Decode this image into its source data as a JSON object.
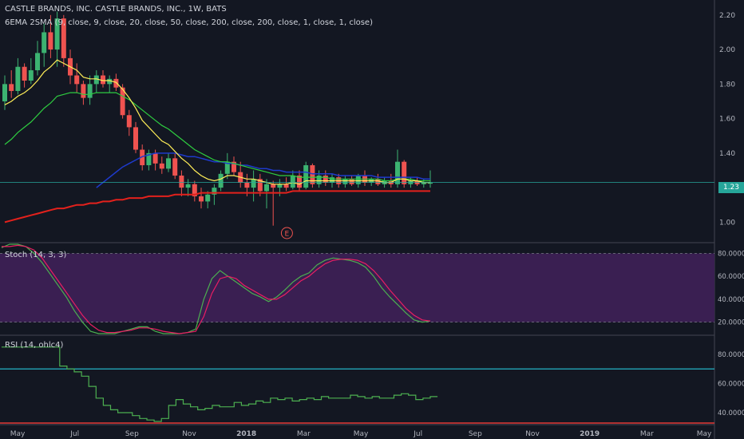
{
  "header": {
    "title": "CASTLE BRANDS, INC. CASTLE BRANDS, INC., 1W, BATS",
    "indicators_label": "6EMA 2SMA (9, close, 9, close, 20, close, 50, close, 200, close, 200, close, 1, close, 1, close)"
  },
  "price_pane": {
    "last_price_label": "1.23",
    "earnings_marker": "E"
  },
  "stoch_pane": {
    "label": "Stoch (14, 3, 3)"
  },
  "rsi_pane": {
    "label": "RSI (14, ohlc4)"
  },
  "colors": {
    "background": "#131722",
    "up": "#26a69a",
    "up_candle": "#3cb371",
    "down": "#ef5350",
    "ema9": "#ffee58",
    "ema20": "#2ecc40",
    "ema50": "#1e3acb",
    "ma200": "#e3211c",
    "stoch_k": "#4caf50",
    "stoch_d": "#e91e63",
    "stoch_band": "#3a1f52",
    "rsi": "#4caf50",
    "rsi_upper": "#26c6da",
    "rsi_lower": "#e53935"
  },
  "chart_data": [
    {
      "type": "candlestick",
      "price_ylim": [
        0.9,
        2.25
      ],
      "y_ticks": [
        "2.20",
        "2.00",
        "1.80",
        "1.60",
        "1.40",
        "1.20",
        "1.00"
      ],
      "x_ticks": [
        "May",
        "Jul",
        "Sep",
        "Nov",
        "2018",
        "Mar",
        "May",
        "Jul",
        "Sep",
        "Nov",
        "2019",
        "Mar",
        "May"
      ],
      "last_price": 1.23,
      "candles": [
        {
          "o": 1.7,
          "h": 1.85,
          "l": 1.65,
          "c": 1.8
        },
        {
          "o": 1.8,
          "h": 1.88,
          "l": 1.72,
          "c": 1.76
        },
        {
          "o": 1.76,
          "h": 1.95,
          "l": 1.74,
          "c": 1.9
        },
        {
          "o": 1.9,
          "h": 1.92,
          "l": 1.78,
          "c": 1.82
        },
        {
          "o": 1.82,
          "h": 1.95,
          "l": 1.8,
          "c": 1.88
        },
        {
          "o": 1.88,
          "h": 2.05,
          "l": 1.85,
          "c": 1.98
        },
        {
          "o": 1.98,
          "h": 2.15,
          "l": 1.9,
          "c": 2.1
        },
        {
          "o": 2.1,
          "h": 2.2,
          "l": 1.95,
          "c": 2.0
        },
        {
          "o": 2.0,
          "h": 2.22,
          "l": 1.9,
          "c": 2.18
        },
        {
          "o": 2.18,
          "h": 2.2,
          "l": 1.9,
          "c": 1.95
        },
        {
          "o": 1.95,
          "h": 2.0,
          "l": 1.8,
          "c": 1.85
        },
        {
          "o": 1.85,
          "h": 1.92,
          "l": 1.75,
          "c": 1.8
        },
        {
          "o": 1.8,
          "h": 1.82,
          "l": 1.68,
          "c": 1.72
        },
        {
          "o": 1.72,
          "h": 1.85,
          "l": 1.68,
          "c": 1.8
        },
        {
          "o": 1.8,
          "h": 1.88,
          "l": 1.75,
          "c": 1.85
        },
        {
          "o": 1.85,
          "h": 1.88,
          "l": 1.78,
          "c": 1.8
        },
        {
          "o": 1.8,
          "h": 1.85,
          "l": 1.75,
          "c": 1.83
        },
        {
          "o": 1.83,
          "h": 1.86,
          "l": 1.76,
          "c": 1.78
        },
        {
          "o": 1.78,
          "h": 1.8,
          "l": 1.6,
          "c": 1.62
        },
        {
          "o": 1.62,
          "h": 1.65,
          "l": 1.5,
          "c": 1.55
        },
        {
          "o": 1.55,
          "h": 1.58,
          "l": 1.4,
          "c": 1.42
        },
        {
          "o": 1.42,
          "h": 1.45,
          "l": 1.3,
          "c": 1.33
        },
        {
          "o": 1.33,
          "h": 1.42,
          "l": 1.3,
          "c": 1.4
        },
        {
          "o": 1.4,
          "h": 1.42,
          "l": 1.3,
          "c": 1.34
        },
        {
          "o": 1.34,
          "h": 1.38,
          "l": 1.28,
          "c": 1.31
        },
        {
          "o": 1.31,
          "h": 1.4,
          "l": 1.29,
          "c": 1.37
        },
        {
          "o": 1.37,
          "h": 1.4,
          "l": 1.25,
          "c": 1.27
        },
        {
          "o": 1.27,
          "h": 1.3,
          "l": 1.15,
          "c": 1.2
        },
        {
          "o": 1.2,
          "h": 1.25,
          "l": 1.15,
          "c": 1.22
        },
        {
          "o": 1.22,
          "h": 1.24,
          "l": 1.12,
          "c": 1.15
        },
        {
          "o": 1.15,
          "h": 1.2,
          "l": 1.08,
          "c": 1.12
        },
        {
          "o": 1.12,
          "h": 1.18,
          "l": 1.08,
          "c": 1.16
        },
        {
          "o": 1.16,
          "h": 1.22,
          "l": 1.1,
          "c": 1.2
        },
        {
          "o": 1.2,
          "h": 1.3,
          "l": 1.18,
          "c": 1.28
        },
        {
          "o": 1.28,
          "h": 1.4,
          "l": 1.25,
          "c": 1.35
        },
        {
          "o": 1.35,
          "h": 1.38,
          "l": 1.27,
          "c": 1.29
        },
        {
          "o": 1.29,
          "h": 1.35,
          "l": 1.2,
          "c": 1.23
        },
        {
          "o": 1.23,
          "h": 1.28,
          "l": 1.15,
          "c": 1.2
        },
        {
          "o": 1.2,
          "h": 1.3,
          "l": 1.12,
          "c": 1.25
        },
        {
          "o": 1.25,
          "h": 1.28,
          "l": 1.15,
          "c": 1.18
        },
        {
          "o": 1.18,
          "h": 1.25,
          "l": 1.08,
          "c": 1.22
        },
        {
          "o": 1.22,
          "h": 1.24,
          "l": 0.98,
          "c": 1.2
        },
        {
          "o": 1.2,
          "h": 1.25,
          "l": 1.15,
          "c": 1.22
        },
        {
          "o": 1.22,
          "h": 1.26,
          "l": 1.18,
          "c": 1.2
        },
        {
          "o": 1.2,
          "h": 1.3,
          "l": 1.19,
          "c": 1.27
        },
        {
          "o": 1.27,
          "h": 1.3,
          "l": 1.18,
          "c": 1.2
        },
        {
          "o": 1.2,
          "h": 1.35,
          "l": 1.19,
          "c": 1.33
        },
        {
          "o": 1.33,
          "h": 1.34,
          "l": 1.2,
          "c": 1.22
        },
        {
          "o": 1.22,
          "h": 1.3,
          "l": 1.2,
          "c": 1.27
        },
        {
          "o": 1.27,
          "h": 1.3,
          "l": 1.21,
          "c": 1.23
        },
        {
          "o": 1.23,
          "h": 1.28,
          "l": 1.2,
          "c": 1.26
        },
        {
          "o": 1.26,
          "h": 1.28,
          "l": 1.2,
          "c": 1.22
        },
        {
          "o": 1.22,
          "h": 1.27,
          "l": 1.2,
          "c": 1.25
        },
        {
          "o": 1.25,
          "h": 1.27,
          "l": 1.21,
          "c": 1.22
        },
        {
          "o": 1.22,
          "h": 1.28,
          "l": 1.2,
          "c": 1.27
        },
        {
          "o": 1.27,
          "h": 1.3,
          "l": 1.21,
          "c": 1.23
        },
        {
          "o": 1.23,
          "h": 1.26,
          "l": 1.21,
          "c": 1.25
        },
        {
          "o": 1.25,
          "h": 1.28,
          "l": 1.21,
          "c": 1.22
        },
        {
          "o": 1.22,
          "h": 1.26,
          "l": 1.2,
          "c": 1.24
        },
        {
          "o": 1.24,
          "h": 1.28,
          "l": 1.2,
          "c": 1.22
        },
        {
          "o": 1.22,
          "h": 1.42,
          "l": 1.2,
          "c": 1.35
        },
        {
          "o": 1.35,
          "h": 1.36,
          "l": 1.2,
          "c": 1.22
        },
        {
          "o": 1.22,
          "h": 1.26,
          "l": 1.2,
          "c": 1.24
        },
        {
          "o": 1.24,
          "h": 1.26,
          "l": 1.21,
          "c": 1.22
        },
        {
          "o": 1.22,
          "h": 1.25,
          "l": 1.2,
          "c": 1.23
        },
        {
          "o": 1.23,
          "h": 1.3,
          "l": 1.2,
          "c": 1.23
        }
      ],
      "ema9": [
        1.68,
        1.7,
        1.73,
        1.75,
        1.78,
        1.82,
        1.87,
        1.9,
        1.94,
        1.92,
        1.9,
        1.88,
        1.84,
        1.83,
        1.83,
        1.82,
        1.82,
        1.81,
        1.77,
        1.72,
        1.66,
        1.59,
        1.55,
        1.51,
        1.47,
        1.45,
        1.41,
        1.37,
        1.34,
        1.3,
        1.27,
        1.25,
        1.24,
        1.25,
        1.27,
        1.27,
        1.26,
        1.25,
        1.25,
        1.24,
        1.23,
        1.22,
        1.22,
        1.22,
        1.23,
        1.22,
        1.24,
        1.24,
        1.24,
        1.24,
        1.24,
        1.24,
        1.24,
        1.24,
        1.24,
        1.24,
        1.24,
        1.24,
        1.23,
        1.23,
        1.25,
        1.25,
        1.24,
        1.24,
        1.23,
        1.23
      ],
      "ema20": [
        1.45,
        1.48,
        1.52,
        1.55,
        1.58,
        1.62,
        1.66,
        1.69,
        1.73,
        1.74,
        1.75,
        1.75,
        1.74,
        1.74,
        1.75,
        1.75,
        1.75,
        1.75,
        1.73,
        1.71,
        1.68,
        1.65,
        1.62,
        1.59,
        1.56,
        1.54,
        1.51,
        1.48,
        1.45,
        1.42,
        1.4,
        1.38,
        1.36,
        1.35,
        1.35,
        1.34,
        1.33,
        1.32,
        1.31,
        1.3,
        1.29,
        1.28,
        1.27,
        1.27,
        1.27,
        1.26,
        1.26,
        1.26,
        1.26,
        1.26,
        1.25,
        1.25,
        1.25,
        1.25,
        1.25,
        1.25,
        1.25,
        1.25,
        1.24,
        1.24,
        1.25,
        1.25,
        1.25,
        1.24,
        1.24,
        1.24
      ],
      "ema50": [
        null,
        null,
        null,
        null,
        null,
        null,
        null,
        null,
        null,
        null,
        null,
        null,
        null,
        null,
        1.2,
        1.23,
        1.26,
        1.29,
        1.32,
        1.34,
        1.36,
        1.38,
        1.39,
        1.4,
        1.4,
        1.4,
        1.4,
        1.39,
        1.38,
        1.38,
        1.37,
        1.36,
        1.35,
        1.35,
        1.34,
        1.34,
        1.33,
        1.33,
        1.32,
        1.31,
        1.31,
        1.3,
        1.3,
        1.29,
        1.29,
        1.29,
        1.29,
        1.28,
        1.28,
        1.28,
        1.28,
        1.27,
        1.27,
        1.27,
        1.27,
        1.27,
        1.27,
        1.26,
        1.26,
        1.26,
        1.26,
        1.26,
        1.26,
        1.26,
        1.25,
        1.25
      ],
      "ma200": [
        1.0,
        1.01,
        1.02,
        1.03,
        1.04,
        1.05,
        1.06,
        1.07,
        1.08,
        1.08,
        1.09,
        1.1,
        1.1,
        1.11,
        1.11,
        1.12,
        1.12,
        1.13,
        1.13,
        1.14,
        1.14,
        1.14,
        1.15,
        1.15,
        1.15,
        1.15,
        1.16,
        1.16,
        1.16,
        1.16,
        1.17,
        1.17,
        1.17,
        1.17,
        1.17,
        1.17,
        1.17,
        1.17,
        1.17,
        1.17,
        1.17,
        1.17,
        1.17,
        1.17,
        1.18,
        1.18,
        1.18,
        1.18,
        1.18,
        1.18,
        1.18,
        1.18,
        1.18,
        1.18,
        1.18,
        1.18,
        1.18,
        1.18,
        1.18,
        1.18,
        1.18,
        1.18,
        1.18,
        1.18,
        1.18,
        1.18
      ],
      "earnings_index": 42
    },
    {
      "type": "line",
      "title": "Stoch (14, 3, 3)",
      "ylim": [
        10,
        88
      ],
      "y_ticks": [
        "80.0000",
        "60.0000",
        "40.0000",
        "20.0000"
      ],
      "bands": [
        20,
        80
      ],
      "series": [
        {
          "values": [
            85,
            88,
            88,
            86,
            80,
            72,
            62,
            52,
            42,
            30,
            20,
            12,
            10,
            10,
            10,
            12,
            14,
            16,
            16,
            12,
            10,
            10,
            10,
            11,
            14,
            40,
            58,
            65,
            60,
            55,
            50,
            45,
            42,
            38,
            42,
            48,
            55,
            60,
            63,
            70,
            74,
            76,
            75,
            74,
            72,
            68,
            60,
            50,
            42,
            35,
            28,
            22,
            20,
            21
          ]
        },
        {
          "values": [
            86,
            86,
            87,
            86,
            83,
            76,
            66,
            56,
            46,
            36,
            26,
            18,
            13,
            11,
            11,
            12,
            13,
            15,
            15,
            14,
            12,
            11,
            10,
            11,
            12,
            25,
            45,
            58,
            60,
            58,
            52,
            48,
            44,
            40,
            40,
            44,
            50,
            56,
            60,
            66,
            71,
            74,
            75,
            75,
            74,
            71,
            65,
            57,
            48,
            40,
            32,
            26,
            22,
            21
          ]
        }
      ]
    },
    {
      "type": "line",
      "title": "RSI (14, ohlc4)",
      "ylim": [
        34,
        92
      ],
      "y_ticks": [
        "80.0000",
        "60.0000",
        "40.0000"
      ],
      "bands": [
        70,
        30
      ],
      "series": [
        {
          "values": [
            85,
            85,
            85,
            85,
            85,
            85,
            85,
            85,
            72,
            70,
            68,
            65,
            58,
            50,
            45,
            42,
            40,
            40,
            38,
            36,
            35,
            34,
            36,
            45,
            49,
            46,
            44,
            42,
            43,
            45,
            44,
            44,
            47,
            45,
            46,
            48,
            47,
            50,
            49,
            50,
            48,
            49,
            50,
            49,
            51,
            50,
            50,
            50,
            52,
            51,
            50,
            51,
            50,
            50,
            52,
            53,
            52,
            49,
            50,
            51
          ]
        }
      ]
    }
  ]
}
